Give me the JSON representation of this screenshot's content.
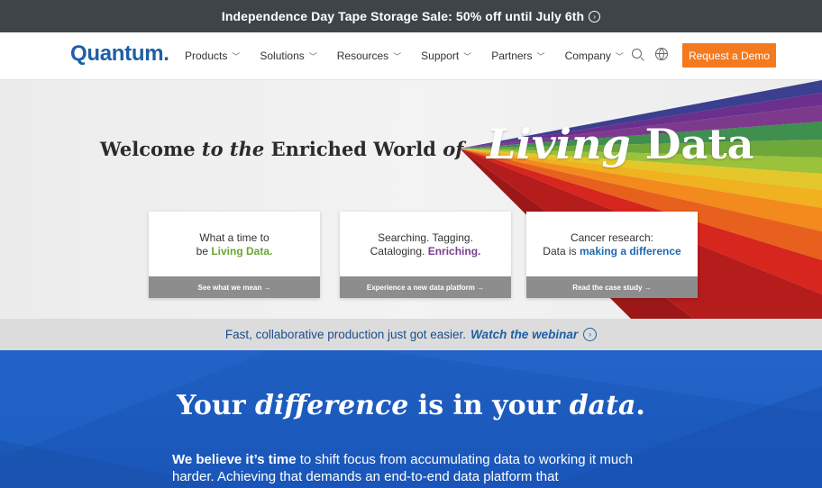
{
  "announcement": {
    "text": "Independence Day Tape Storage Sale: 50% off until July 6th",
    "icon": "chevron-right-circle-icon"
  },
  "nav": {
    "logo": "Quantum",
    "items": [
      {
        "label": "Products"
      },
      {
        "label": "Solutions"
      },
      {
        "label": "Resources"
      },
      {
        "label": "Support"
      },
      {
        "label": "Partners"
      },
      {
        "label": "Company"
      }
    ],
    "cta": "Request a Demo"
  },
  "hero": {
    "headline_a": "Welcome ",
    "headline_b": "to the",
    "headline_c": " Enriched World ",
    "headline_d": "of",
    "living": "Living",
    "data": " Data",
    "cards": [
      {
        "line1": "What a time to",
        "line2a": "be ",
        "line2b": "Living Data.",
        "link": "See what we mean →"
      },
      {
        "line1": "Searching. Tagging.",
        "line2a": "Cataloging. ",
        "line2b": "Enriching.",
        "link": "Experience a new data platform →"
      },
      {
        "line1": "Cancer research:",
        "line2a": "Data is ",
        "line2b": "making a difference",
        "link": "Read the case study →"
      }
    ]
  },
  "promo": {
    "text": "Fast, collaborative production just got easier.",
    "link": "Watch the webinar"
  },
  "section": {
    "title_a": "Your ",
    "title_b": "difference",
    "title_c": " is in your ",
    "title_d": "data",
    "title_e": ".",
    "body_bold": "We believe it’s time",
    "body": " to shift focus from accumulating data to working it much harder. Achieving that demands an end-to-end data platform that"
  },
  "colors": {
    "brand": "#1e5fa6",
    "cta": "#f47a20",
    "topbar": "#3f4449",
    "section_bg": "#1f5fc2"
  }
}
